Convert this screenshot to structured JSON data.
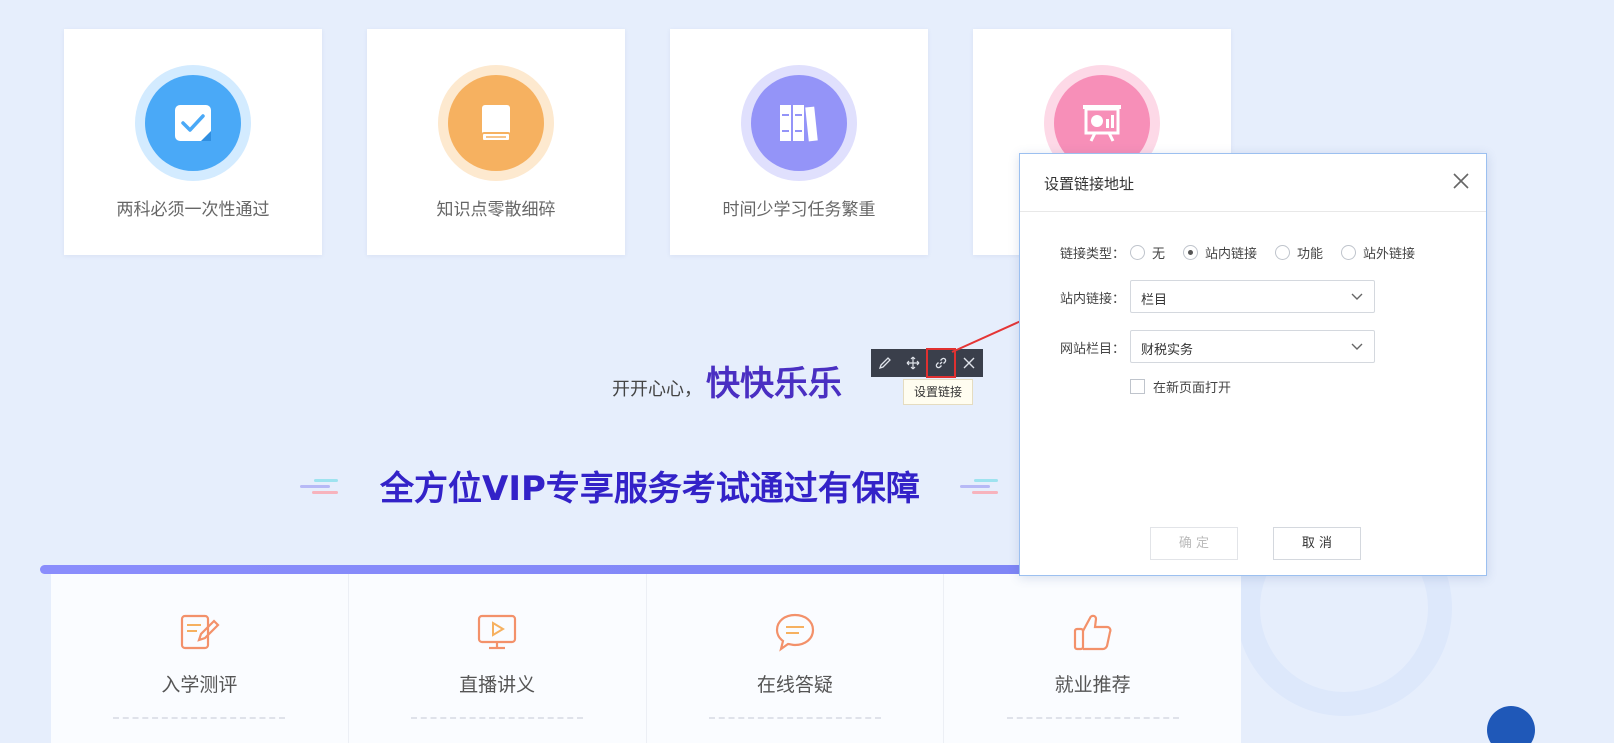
{
  "cards": [
    {
      "label": "两科必须一次性通过",
      "icon": "checklist-icon",
      "color": "#4aa9f7",
      "halo": "#d3ebff"
    },
    {
      "label": "知识点零散细碎",
      "icon": "book-icon",
      "color": "#f6b160",
      "halo": "#fde9cf"
    },
    {
      "label": "时间少学习任务繁重",
      "icon": "books-icon",
      "color": "#9494f8",
      "halo": "#e0e0fd"
    },
    {
      "label": "",
      "icon": "presentation-icon",
      "color": "#f78fb8",
      "halo": "#fdd9e7"
    }
  ],
  "slogan": {
    "small": "开开心心，",
    "big": "快快乐乐"
  },
  "section_title": "全方位VIP专享服务考试通过有保障",
  "toolbar": {
    "buttons": [
      "edit-icon",
      "move-icon",
      "link-icon",
      "close-icon"
    ],
    "tooltip": "设置链接"
  },
  "services": [
    {
      "label": "入学测评",
      "icon": "pencil-note-icon"
    },
    {
      "label": "直播讲义",
      "icon": "video-screen-icon"
    },
    {
      "label": "在线答疑",
      "icon": "chat-bubble-icon"
    },
    {
      "label": "就业推荐",
      "icon": "thumbs-up-icon"
    }
  ],
  "dialog": {
    "title": "设置链接地址",
    "link_type_label": "链接类型：",
    "link_types": [
      {
        "label": "无",
        "selected": false
      },
      {
        "label": "站内链接",
        "selected": true
      },
      {
        "label": "功能",
        "selected": false
      },
      {
        "label": "站外链接",
        "selected": false
      }
    ],
    "inner_link_label": "站内链接：",
    "inner_link_value": "栏目",
    "column_label": "网站栏目：",
    "column_value": "财税实务",
    "open_new_page": "在新页面打开",
    "open_new_page_checked": false,
    "ok_label": "确 定",
    "cancel_label": "取 消"
  },
  "colors": {
    "accent": "#3322c8",
    "toolbar_bg": "#3a3f4b",
    "highlight": "#e03030"
  }
}
